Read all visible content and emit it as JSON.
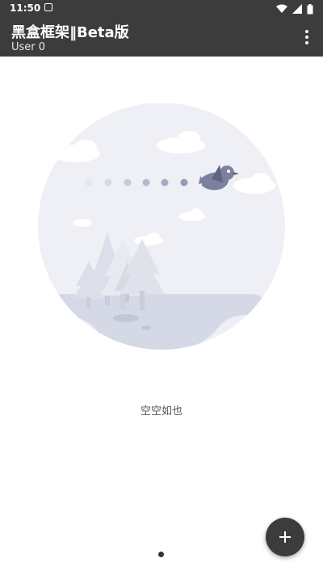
{
  "status_bar": {
    "time": "11:50",
    "icons": [
      "notification-icon",
      "wifi-icon",
      "signal-icon",
      "battery-icon"
    ]
  },
  "app_bar": {
    "title": "黑盒框架‖Beta版",
    "subtitle": "User 0",
    "menu_icon": "more-vert-icon",
    "background_color": "#3c3c3c"
  },
  "empty_state": {
    "message": "空空如也"
  },
  "fab": {
    "icon": "add-icon",
    "color": "#3c3c3c"
  }
}
